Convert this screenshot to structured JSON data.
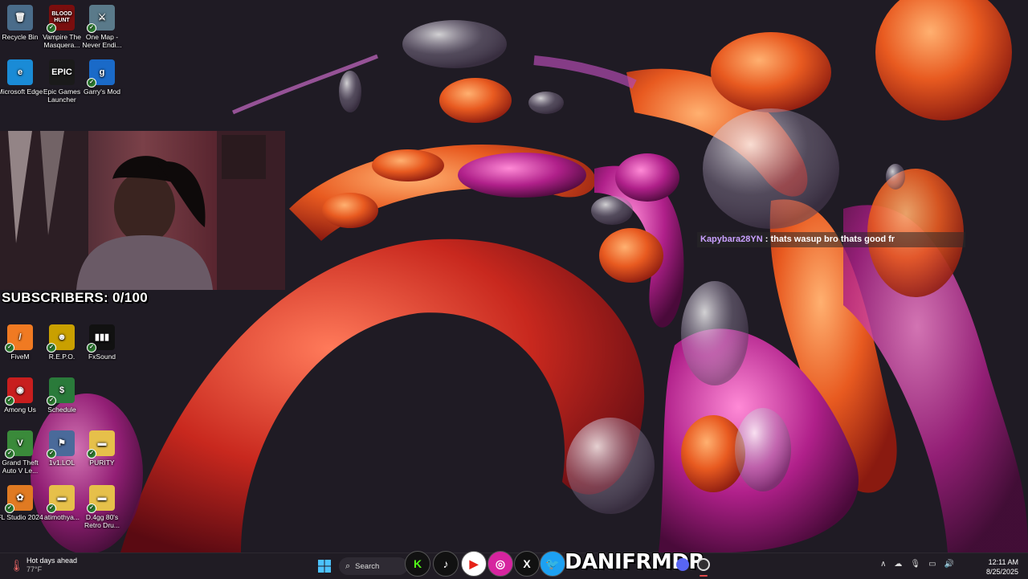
{
  "desktop_icons": [
    {
      "name": "recycle-bin-icon",
      "label": "Recycle Bin",
      "glyph": "🗑",
      "color": "#4a6c8a",
      "check": false
    },
    {
      "name": "vampire-icon",
      "label": "Vampire The Masquera...",
      "glyph": "BLOOD HUNT",
      "color": "#7a0e0e",
      "check": true
    },
    {
      "name": "one-map-icon",
      "label": "One Map - Never Endi...",
      "glyph": "⚔",
      "color": "#5a7a8a",
      "check": true
    },
    {
      "name": "edge-icon",
      "label": "Microsoft Edge",
      "glyph": "e",
      "color": "#1a8bd6",
      "check": false
    },
    {
      "name": "epic-games-icon",
      "label": "Epic Games Launcher",
      "glyph": "EPIC",
      "color": "#1a1a1a",
      "check": false
    },
    {
      "name": "garrys-mod-icon",
      "label": "Garry's Mod",
      "glyph": "g",
      "color": "#1a6ac8",
      "check": true
    },
    {
      "name": "fivem-icon",
      "label": "FiveM",
      "glyph": "/",
      "color": "#f07a22",
      "check": true
    },
    {
      "name": "repo-icon",
      "label": "R.E.P.O.",
      "glyph": "☻",
      "color": "#c9a000",
      "check": true
    },
    {
      "name": "fxsound-icon",
      "label": "FxSound",
      "glyph": "▮▮▮",
      "color": "#111111",
      "check": true
    },
    {
      "name": "among-us-icon",
      "label": "Among Us",
      "glyph": "◉",
      "color": "#c81e1e",
      "check": true
    },
    {
      "name": "schedule-icon",
      "label": "Schedule",
      "glyph": "$",
      "color": "#2a7a3a",
      "check": true
    },
    {
      "name": "gta-icon",
      "label": "Grand Theft Auto V Le...",
      "glyph": "V",
      "color": "#3a8a3a",
      "check": true
    },
    {
      "name": "1v1lol-icon",
      "label": "1v1.LOL",
      "glyph": "⚑",
      "color": "#4a6a9a",
      "check": true
    },
    {
      "name": "purity-folder-icon",
      "label": "PURITY",
      "glyph": "▬",
      "color": "#e6c04a",
      "check": true
    },
    {
      "name": "fl-studio-icon",
      "label": "FL Studio 2024",
      "glyph": "✿",
      "color": "#e07a22",
      "check": true
    },
    {
      "name": "atimothya-folder-icon",
      "label": "atimothya...",
      "glyph": "▬",
      "color": "#e6c04a",
      "check": true
    },
    {
      "name": "d4gg-folder-icon",
      "label": "D.4gg 80's Retro Dru...",
      "glyph": "▬",
      "color": "#e6c04a",
      "check": true
    }
  ],
  "overlay": {
    "subscribers_text": "SUBSCRIBERS: 0/100",
    "chat_user": "Kapybara28YN",
    "chat_message": ": thats wasup bro thats good fr"
  },
  "taskbar": {
    "weather_title": "Hot days ahead",
    "weather_temp": "77°F",
    "search_placeholder": "Search",
    "brand": "DANIFRMDR",
    "time": "12:11 AM",
    "date": "8/25/2025"
  },
  "socials": [
    {
      "name": "kick-icon",
      "glyph": "K",
      "bg": "#111111",
      "fg": "#53fc18"
    },
    {
      "name": "tiktok-icon",
      "glyph": "♪",
      "bg": "#111111",
      "fg": "#ffffff"
    },
    {
      "name": "youtube-icon",
      "glyph": "▶",
      "bg": "#ffffff",
      "fg": "#e62117"
    },
    {
      "name": "instagram-icon",
      "glyph": "◎",
      "bg": "#d6249f",
      "fg": "#ffffff"
    },
    {
      "name": "x-icon",
      "glyph": "X",
      "bg": "#111111",
      "fg": "#ffffff"
    },
    {
      "name": "twitter-icon",
      "glyph": "🐦",
      "bg": "#1da1f2",
      "fg": "#ffffff"
    }
  ]
}
